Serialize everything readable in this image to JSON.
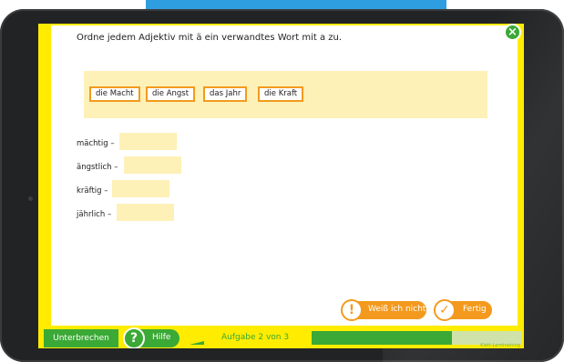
{
  "task": {
    "instruction": "Ordne jedem Adjektiv mit ä ein verwandtes Wort mit a zu."
  },
  "word_bank": [
    "die Macht",
    "die Angst",
    "das Jahr",
    "die Kraft"
  ],
  "rows": [
    {
      "label": "mächtig –",
      "value": ""
    },
    {
      "label": "ängstlich –",
      "value": ""
    },
    {
      "label": "kräftig –",
      "value": ""
    },
    {
      "label": "jährlich –",
      "value": ""
    }
  ],
  "actions": {
    "dont_know_label": "Weiß ich nicht",
    "dont_know_icon": "exclamation-icon",
    "done_label": "Fertig",
    "done_icon": "checkmark-icon",
    "close_icon": "close-icon"
  },
  "footer": {
    "interrupt_label": "Unterbrechen",
    "help_label": "Hilfe",
    "help_icon": "question-icon",
    "task_counter": "Aufgabe 2 von 3",
    "progress": 0.67,
    "publisher": "Klett-Lerntraining"
  },
  "colors": {
    "frame_yellow": "#ffec00",
    "accent_green": "#3aa935",
    "accent_orange": "#f39a1e",
    "field_beige": "#fdf1b8"
  }
}
